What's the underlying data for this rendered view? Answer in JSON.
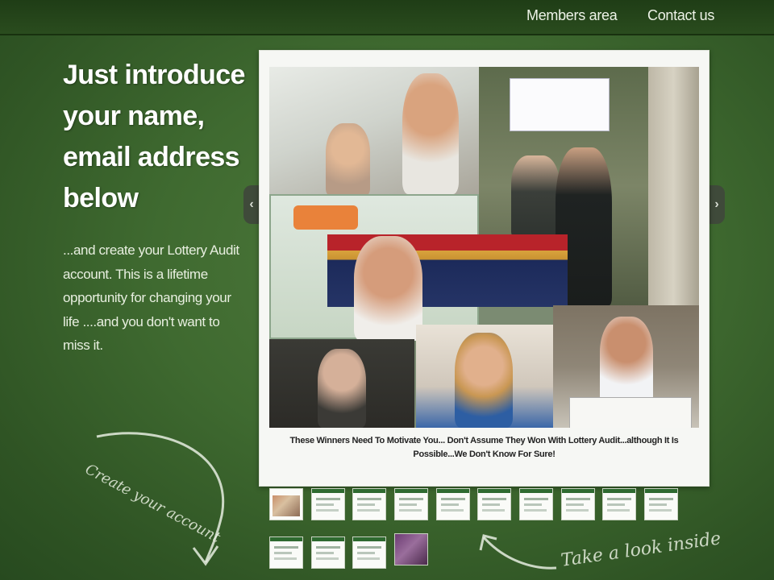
{
  "nav": {
    "members": "Members area",
    "contact": "Contact us"
  },
  "hero": {
    "headline": "Just introduce your name, email address below",
    "subtext": "...and create your Lottery Audit account. This is a lifetime opportunity for changing your life ....and you don't want to miss it."
  },
  "slideshow": {
    "caption": "These Winners Need To Motivate You... Don't Assume They Won With Lottery Audit...although It Is Possible...We Don't Know For Sure!",
    "prev_icon": "chevron-left-icon",
    "next_icon": "chevron-right-icon",
    "prev_glyph": "‹",
    "next_glyph": "›",
    "thumbnail_count": 14,
    "selected_thumbnail": 14
  },
  "annotations": {
    "create_account": "Create your account",
    "take_a_look": "Take a look inside"
  },
  "colors": {
    "background": "#3f6a30",
    "topbar": "#1f3d16",
    "accent_green": "#2e6a30"
  }
}
